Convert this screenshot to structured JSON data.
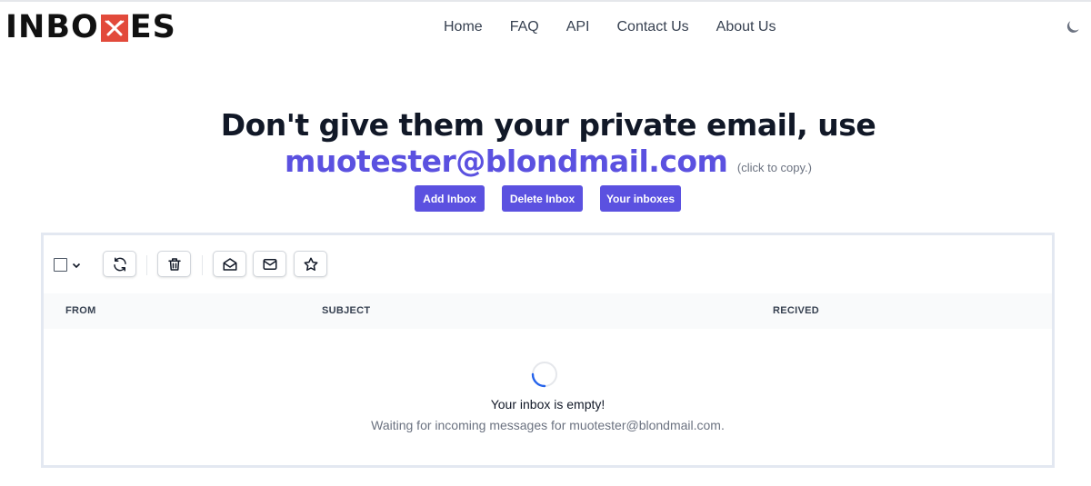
{
  "brand": {
    "logo_left": "INBO",
    "logo_right": "ES",
    "accent": "#e24a3b"
  },
  "nav": {
    "items": [
      {
        "label": "Home"
      },
      {
        "label": "FAQ"
      },
      {
        "label": "API"
      },
      {
        "label": "Contact Us"
      },
      {
        "label": "About Us"
      }
    ],
    "theme_toggle_icon": "moon-icon"
  },
  "hero": {
    "title": "Don't give them your private email, use",
    "email": "muotester@blondmail.com",
    "copy_hint": "(click to copy.)",
    "email_color": "#5b51e0"
  },
  "actions": {
    "add_inbox": "Add Inbox",
    "delete_inbox": "Delete Inbox",
    "your_inboxes": "Your inboxes",
    "button_color": "#5b51e0"
  },
  "toolbar": {
    "icons": [
      "checkbox",
      "chevron-down-icon",
      "refresh-icon",
      "trash-icon",
      "mail-open-icon",
      "mail-icon",
      "star-icon"
    ]
  },
  "table": {
    "columns": [
      "FROM",
      "SUBJECT",
      "RECIVED"
    ]
  },
  "empty_state": {
    "title": "Your inbox is empty!",
    "subtitle": "Waiting for incoming messages for muotester@blondmail.com."
  }
}
